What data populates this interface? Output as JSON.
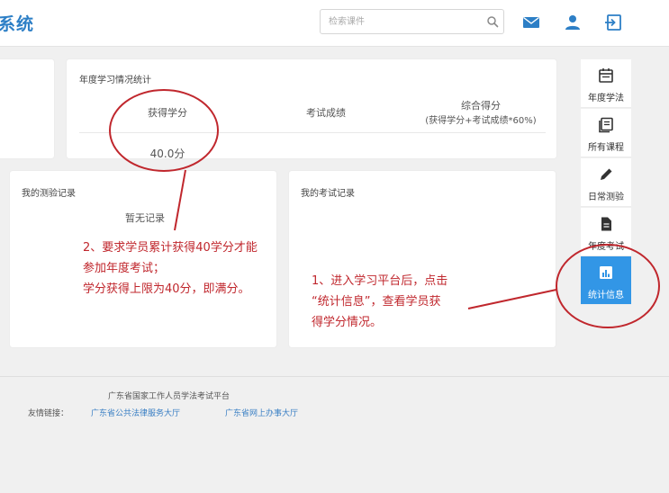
{
  "header": {
    "brand": "系统",
    "search_placeholder": "检索课件",
    "icons": [
      "mail-icon",
      "user-icon",
      "logout-icon"
    ]
  },
  "stats": {
    "title": "年度学习情况统计",
    "col_credits": "获得学分",
    "col_exam_score": "考试成绩",
    "col_total_line1": "综合得分",
    "col_total_line2": "(获得学分+考试成绩*60%)",
    "credits_value": "40.0分"
  },
  "quiz_records": {
    "title": "我的测验记录",
    "empty_text": "暂无记录"
  },
  "exam_records": {
    "title": "我的考试记录"
  },
  "side_nav": {
    "items": [
      {
        "label": "年度学法",
        "icon": "calendar-icon"
      },
      {
        "label": "所有课程",
        "icon": "book-icon"
      },
      {
        "label": "日常测验",
        "icon": "pencil-icon"
      },
      {
        "label": "年度考试",
        "icon": "document-icon"
      },
      {
        "label": "统计信息",
        "icon": "bar-chart-icon"
      }
    ]
  },
  "annotations": {
    "note2": [
      "2、要求学员累计获得40学分才能",
      "参加年度考试；",
      "学分获得上限为40分，即满分。"
    ],
    "note1": [
      "1、进入学习平台后，点击",
      "“统计信息”，查看学员获",
      "得学分情况。"
    ]
  },
  "footer": {
    "org": "广东省国家工作人员学法考试平台",
    "links_label": "友情链接：",
    "link1": "广东省公共法律服务大厅",
    "link2": "广东省网上办事大厅"
  },
  "colors": {
    "brand": "#2d7fc6",
    "active_nav": "#3296e6",
    "annotation": "#c0272d",
    "link": "#3a7fc4"
  }
}
